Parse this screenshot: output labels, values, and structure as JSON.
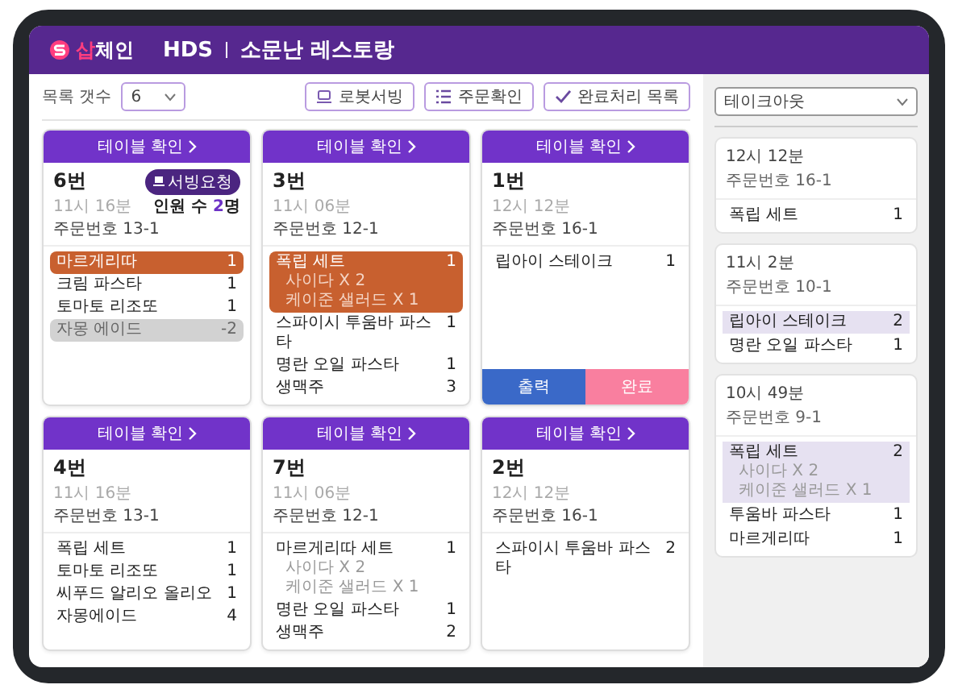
{
  "header": {
    "logo": {
      "accent": "삽",
      "rest": "체인"
    },
    "brand": "HDS",
    "title": "소문난 레스토랑"
  },
  "toolbar": {
    "count_label": "목록 갯수",
    "count_value": "6",
    "buttons": [
      {
        "kind": "robot",
        "label": "로봇서빙"
      },
      {
        "kind": "orders",
        "label": "주문확인"
      },
      {
        "kind": "completed",
        "label": "완료처리 목록"
      }
    ]
  },
  "orders": [
    {
      "header": "테이블 확인",
      "table": "6번",
      "time": "11시 16분",
      "order_no": "주문번호 13-1",
      "badge": "서빙요청",
      "guests": {
        "label": "인원 수",
        "count": "2",
        "unit": "명"
      },
      "items": [
        {
          "kind": "active",
          "name": "마르게리따",
          "qty": "1"
        },
        {
          "kind": "plain",
          "name": "크림 파스타",
          "qty": "1"
        },
        {
          "kind": "plain",
          "name": "토마토 리조또",
          "qty": "1"
        },
        {
          "kind": "voided",
          "name": "자몽 에이드",
          "qty": "-2"
        }
      ]
    },
    {
      "header": "테이블 확인",
      "table": "3번",
      "time": "11시 06분",
      "order_no": "주문번호 12-1",
      "items": [
        {
          "kind": "active",
          "name": "폭립 세트",
          "qty": "1",
          "options": [
            "사이다 X 2",
            "케이준 샐러드 X 1"
          ]
        },
        {
          "kind": "plain",
          "name": "스파이시 투움바 파스타",
          "qty": "1"
        },
        {
          "kind": "plain",
          "name": "명란 오일 파스타",
          "qty": "1"
        },
        {
          "kind": "plain",
          "name": "생맥주",
          "qty": "3"
        }
      ]
    },
    {
      "header": "테이블 확인",
      "table": "1번",
      "time": "12시 12분",
      "order_no": "주문번호 16-1",
      "items": [
        {
          "kind": "plain",
          "name": "립아이 스테이크",
          "qty": "1"
        }
      ],
      "actions": [
        {
          "kind": "print",
          "label": "출력"
        },
        {
          "kind": "done",
          "label": "완료"
        }
      ]
    },
    {
      "header": "테이블 확인",
      "table": "4번",
      "time": "11시 16분",
      "order_no": "주문번호 13-1",
      "items": [
        {
          "kind": "plain",
          "name": "폭립 세트",
          "qty": "1"
        },
        {
          "kind": "plain",
          "name": "토마토 리조또",
          "qty": "1"
        },
        {
          "kind": "plain",
          "name": "씨푸드 알리오 올리오",
          "qty": "1"
        },
        {
          "kind": "plain",
          "name": "자몽에이드",
          "qty": "4"
        }
      ]
    },
    {
      "header": "테이블 확인",
      "table": "7번",
      "time": "11시 06분",
      "order_no": "주문번호 12-1",
      "items": [
        {
          "kind": "plain",
          "name": "마르게리따 세트",
          "qty": "1",
          "options": [
            "사이다 X 2",
            "케이준 샐러드 X 1"
          ]
        },
        {
          "kind": "plain",
          "name": "명란 오일 파스타",
          "qty": "1"
        },
        {
          "kind": "plain",
          "name": "생맥주",
          "qty": "2"
        }
      ]
    },
    {
      "header": "테이블 확인",
      "table": "2번",
      "time": "12시 12분",
      "order_no": "주문번호 16-1",
      "items": [
        {
          "kind": "plain",
          "name": "스파이시 투움바 파스타",
          "qty": "2"
        }
      ]
    }
  ],
  "sidebar": {
    "filter": "테이크아웃",
    "orders": [
      {
        "time": "12시 12분",
        "order_no": "주문번호 16-1",
        "items": [
          {
            "highlighted": false,
            "name": "폭립 세트",
            "qty": "1"
          }
        ]
      },
      {
        "time": "11시 2분",
        "order_no": "주문번호 10-1",
        "items": [
          {
            "highlighted": true,
            "name": "립아이 스테이크",
            "qty": "2"
          },
          {
            "highlighted": false,
            "name": "명란 오일 파스타",
            "qty": "1"
          }
        ]
      },
      {
        "time": "10시 49분",
        "order_no": "주문번호 9-1",
        "items": [
          {
            "highlighted": true,
            "name": "폭립 세트",
            "qty": "2",
            "options": [
              "사이다 X 2",
              "케이준 샐러드 X 1"
            ]
          },
          {
            "highlighted": false,
            "name": "투움바 파스타",
            "qty": "1"
          },
          {
            "highlighted": false,
            "name": "마르게리따",
            "qty": "1"
          }
        ]
      }
    ]
  }
}
